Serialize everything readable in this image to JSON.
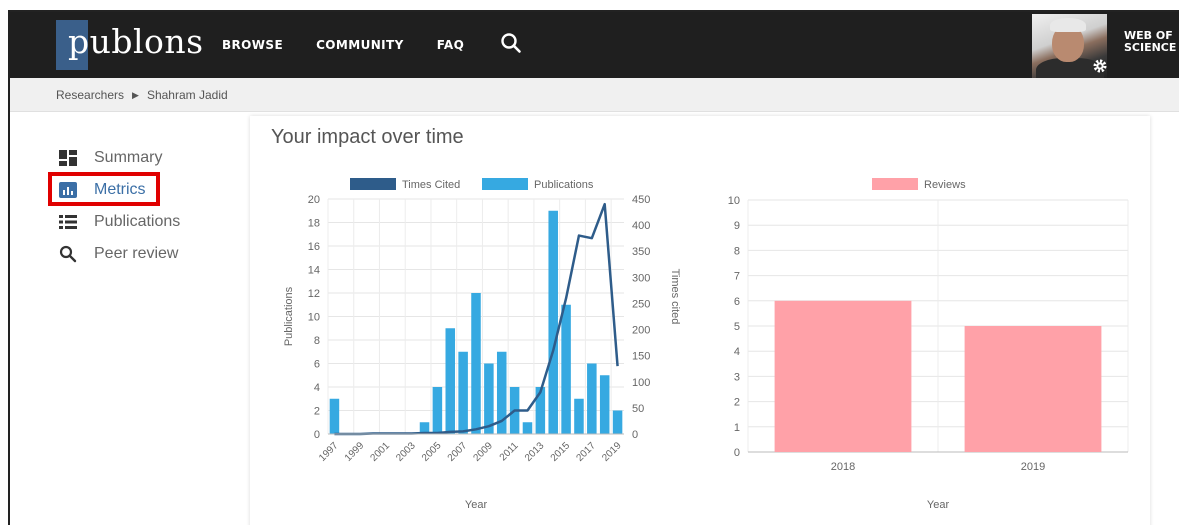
{
  "header": {
    "logo": "publons",
    "nav": [
      "BROWSE",
      "COMMUNITY",
      "FAQ"
    ],
    "wos_line1": "WEB OF",
    "wos_line2": "SCIENCE"
  },
  "breadcrumb": {
    "root": "Researchers",
    "current": "Shahram Jadid"
  },
  "sidebar": {
    "items": [
      {
        "label": "Summary",
        "icon": "dashboard-icon"
      },
      {
        "label": "Metrics",
        "icon": "bar-chart-icon"
      },
      {
        "label": "Publications",
        "icon": "list-icon"
      },
      {
        "label": "Peer review",
        "icon": "search-icon"
      }
    ]
  },
  "main": {
    "title": "Your impact over time"
  },
  "colors": {
    "times_cited": "#2e5c8a",
    "publications": "#36a9e1",
    "reviews": "#ffa1a8",
    "active_nav": "#3b6fa6",
    "highlight": "#e00000"
  },
  "chart_data": [
    {
      "type": "bar",
      "categories": [
        "1997",
        "1998",
        "1999",
        "2000",
        "2001",
        "2002",
        "2003",
        "2004",
        "2005",
        "2006",
        "2007",
        "2008",
        "2009",
        "2010",
        "2011",
        "2012",
        "2013",
        "2014",
        "2015",
        "2016",
        "2017",
        "2018",
        "2019"
      ],
      "x_tick_labels": [
        "1997",
        "1999",
        "2001",
        "2003",
        "2005",
        "2007",
        "2009",
        "2011",
        "2013",
        "2015",
        "2017",
        "2019"
      ],
      "series": [
        {
          "name": "Publications",
          "axis": "left",
          "type": "bar",
          "values": [
            3,
            0,
            0,
            0,
            0,
            0,
            0,
            1,
            4,
            9,
            7,
            12,
            6,
            7,
            4,
            1,
            4,
            19,
            11,
            3,
            6,
            5,
            2
          ]
        },
        {
          "name": "Times Cited",
          "axis": "right",
          "type": "line",
          "values": [
            0,
            0,
            0,
            1,
            1,
            1,
            1,
            2,
            2,
            4,
            5,
            9,
            15,
            25,
            45,
            45,
            80,
            160,
            260,
            380,
            375,
            440,
            130
          ]
        }
      ],
      "xlabel": "Year",
      "ylabel": "Publications",
      "ylabel_right": "Times cited",
      "ylim": [
        0,
        20
      ],
      "ylim_right": [
        0,
        450
      ],
      "y_ticks": [
        0,
        2,
        4,
        6,
        8,
        10,
        12,
        14,
        16,
        18,
        20
      ],
      "y_ticks_right": [
        0,
        50,
        100,
        150,
        200,
        250,
        300,
        350,
        400,
        450
      ],
      "legend": "top",
      "grid": true
    },
    {
      "type": "bar",
      "categories": [
        "2018",
        "2019"
      ],
      "series": [
        {
          "name": "Reviews",
          "values": [
            6,
            5
          ]
        }
      ],
      "xlabel": "Year",
      "ylabel": "",
      "ylim": [
        0,
        10
      ],
      "y_ticks": [
        0,
        1,
        2,
        3,
        4,
        5,
        6,
        7,
        8,
        9,
        10
      ],
      "legend": "top",
      "grid": true
    }
  ]
}
